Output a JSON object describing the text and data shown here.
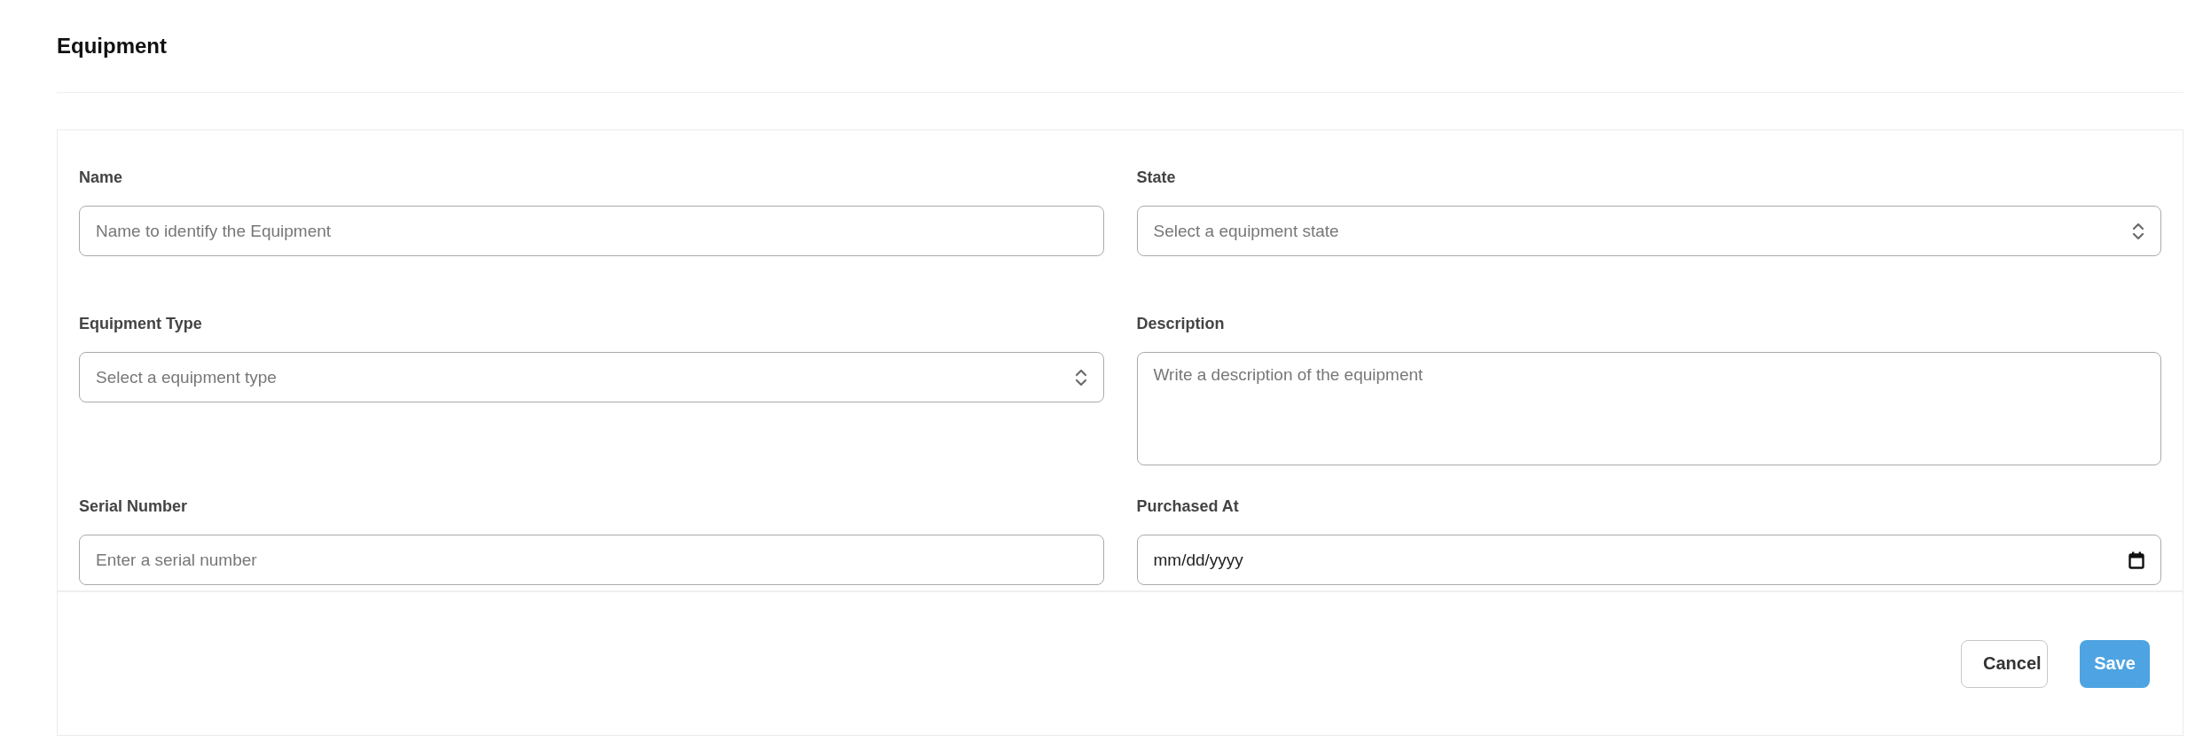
{
  "page": {
    "title": "Equipment"
  },
  "form": {
    "fields": [
      {
        "kind": "text",
        "label": "Name",
        "placeholder": "Name to identify the Equipment"
      },
      {
        "kind": "select",
        "label": "State",
        "placeholder": "Select a equipment state"
      },
      {
        "kind": "select",
        "label": "Equipment Type",
        "placeholder": "Select a equipment type"
      },
      {
        "kind": "textarea",
        "label": "Description",
        "placeholder": "Write a description of the equipment"
      },
      {
        "kind": "text",
        "label": "Serial Number",
        "placeholder": "Enter a serial number"
      },
      {
        "kind": "date",
        "label": "Purchased At",
        "value": "mm/dd/yyyy"
      }
    ],
    "buttons": [
      {
        "kind": "secondary",
        "label": "Cancel"
      },
      {
        "kind": "primary",
        "label": "Save"
      }
    ]
  }
}
